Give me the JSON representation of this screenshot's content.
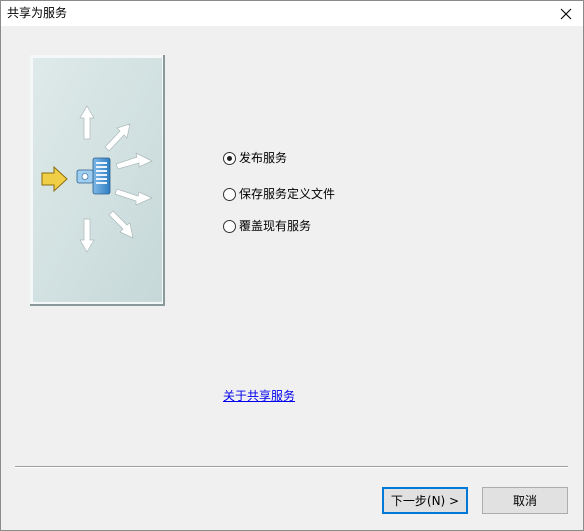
{
  "window": {
    "title": "共享为服务"
  },
  "options": [
    {
      "label": "发布服务",
      "checked": true
    },
    {
      "label": "保存服务定义文件",
      "checked": false
    },
    {
      "label": "覆盖现有服务",
      "checked": false
    }
  ],
  "link": {
    "label": "关于共享服务"
  },
  "buttons": {
    "next_label": "下一步(N) >",
    "cancel_label": "取消"
  },
  "icons": {
    "close": "close-icon",
    "illustration": "share-service-illustration",
    "input_arrow": "arrow-right-icon",
    "server": "server-icon"
  },
  "colors": {
    "panel_bg": "#cfdfdf",
    "accent": "#0078d7",
    "link": "#0000ee",
    "input_arrow": "#e8c23a"
  }
}
